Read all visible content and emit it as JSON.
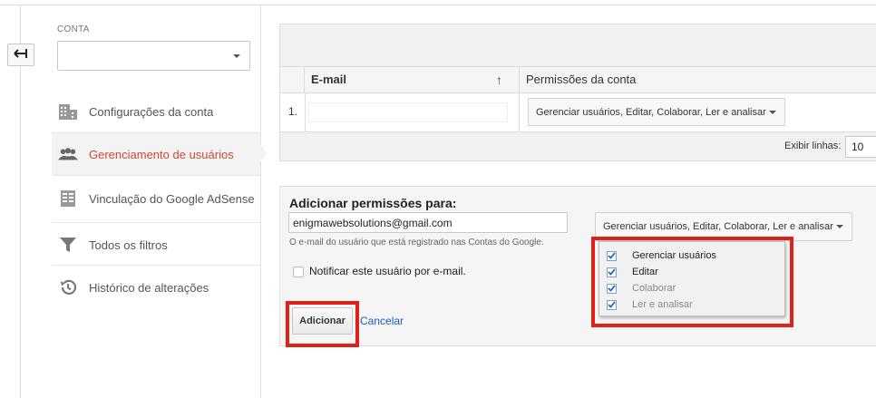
{
  "sidebar": {
    "account_label": "CONTA",
    "account_value": "",
    "items": [
      {
        "label": "Configurações da conta",
        "icon": "building-icon",
        "active": false
      },
      {
        "label": "Gerenciamento de usuários",
        "icon": "users-icon",
        "active": true
      },
      {
        "label": "Vinculação do Google AdSense",
        "icon": "adsense-icon",
        "active": false
      },
      {
        "label": "Todos os filtros",
        "icon": "filter-icon",
        "active": false
      },
      {
        "label": "Histórico de alterações",
        "icon": "history-icon",
        "active": false
      }
    ]
  },
  "users_table": {
    "headers": {
      "email": "E-mail",
      "permissions": "Permissões da conta"
    },
    "rows": [
      {
        "num": "1.",
        "email": "",
        "permissions": "Gerenciar usuários, Editar, Colaborar, Ler e analisar"
      }
    ],
    "rows_label": "Exibir linhas:",
    "rows_value": "10"
  },
  "add_permissions": {
    "title": "Adicionar permissões para:",
    "email_value": "enigmawebsolutions@gmail.com",
    "email_help": "O e-mail do usuário que está registrado nas Contas do Google.",
    "notify_label": "Notificar este usuário por e-mail.",
    "notify_checked": false,
    "permissions_value": "Gerenciar usuários, Editar, Colaborar, Ler e analisar",
    "permission_options": [
      {
        "label": "Gerenciar usuários",
        "checked": true,
        "disabled": false
      },
      {
        "label": "Editar",
        "checked": true,
        "disabled": false
      },
      {
        "label": "Colaborar",
        "checked": true,
        "disabled": true
      },
      {
        "label": "Ler e analisar",
        "checked": true,
        "disabled": true
      }
    ],
    "add_button": "Adicionar",
    "cancel_link": "Cancelar"
  },
  "colors": {
    "active_nav": "#d14836",
    "highlight_box": "#e0201b",
    "link": "#1a5fb4"
  }
}
